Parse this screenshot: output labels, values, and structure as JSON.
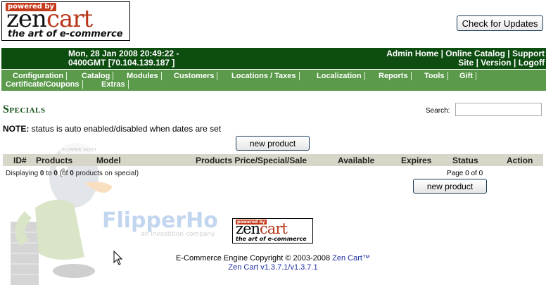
{
  "logo": {
    "powered_by": "powered by",
    "brand_zen": "zen",
    "brand_cart": "cart",
    "tagline": "the art of e-commerce"
  },
  "check_updates_label": "Check for Updates",
  "header": {
    "datetime_line1": "Mon, 28 Jan 2008 20:49:22 -",
    "datetime_line2": "0400GMT [70.104.139.187 ]",
    "links_line1": [
      "Admin Home",
      "Online Catalog",
      "Support"
    ],
    "links_line2": [
      "Site",
      "Version",
      "Logoff"
    ],
    "separator": "|"
  },
  "menu": {
    "items": [
      "Configuration",
      "Catalog",
      "Modules",
      "Customers",
      "Locations / Taxes",
      "Localization",
      "Reports",
      "Tools",
      "Gift",
      "Certificate/Coupons",
      "Extras"
    ]
  },
  "page": {
    "title": "Specials",
    "search_label": "Search:",
    "search_value": "",
    "note_label": "NOTE:",
    "note_text": " status is auto enabled/disabled when dates are set",
    "new_product_label": "new product"
  },
  "table": {
    "columns": [
      "ID#",
      "Products",
      "Model",
      "Products Price/Special/Sale",
      "Available",
      "Expires",
      "Status",
      "Action"
    ],
    "rows": []
  },
  "pagination": {
    "prefix": "Displaying ",
    "from": "0",
    "to_word": " to ",
    "to": "0",
    "of_open": " (of ",
    "total": "0",
    "suffix": " products on special)",
    "page_info": "Page 0 of 0"
  },
  "watermark": {
    "text": "FlipperHost",
    "sub": "an investition company",
    "mascot_text": "FLIPPER HOST"
  },
  "footer": {
    "logo_powered_by": "powered by",
    "logo_zen": "zen",
    "logo_cart": "cart",
    "logo_tagline": "the art of e-commerce",
    "copyright_text": "E-Commerce Engine Copyright © 2003-2008 ",
    "copyright_link": "Zen Cart™",
    "version_link": "Zen Cart v1.3.7.1/v1.3.7.1"
  },
  "colors": {
    "header_green": "#0e4d10",
    "menu_green": "#5b9a4b",
    "link_blue": "#1d2fa3",
    "brand_red": "#b8361a"
  }
}
